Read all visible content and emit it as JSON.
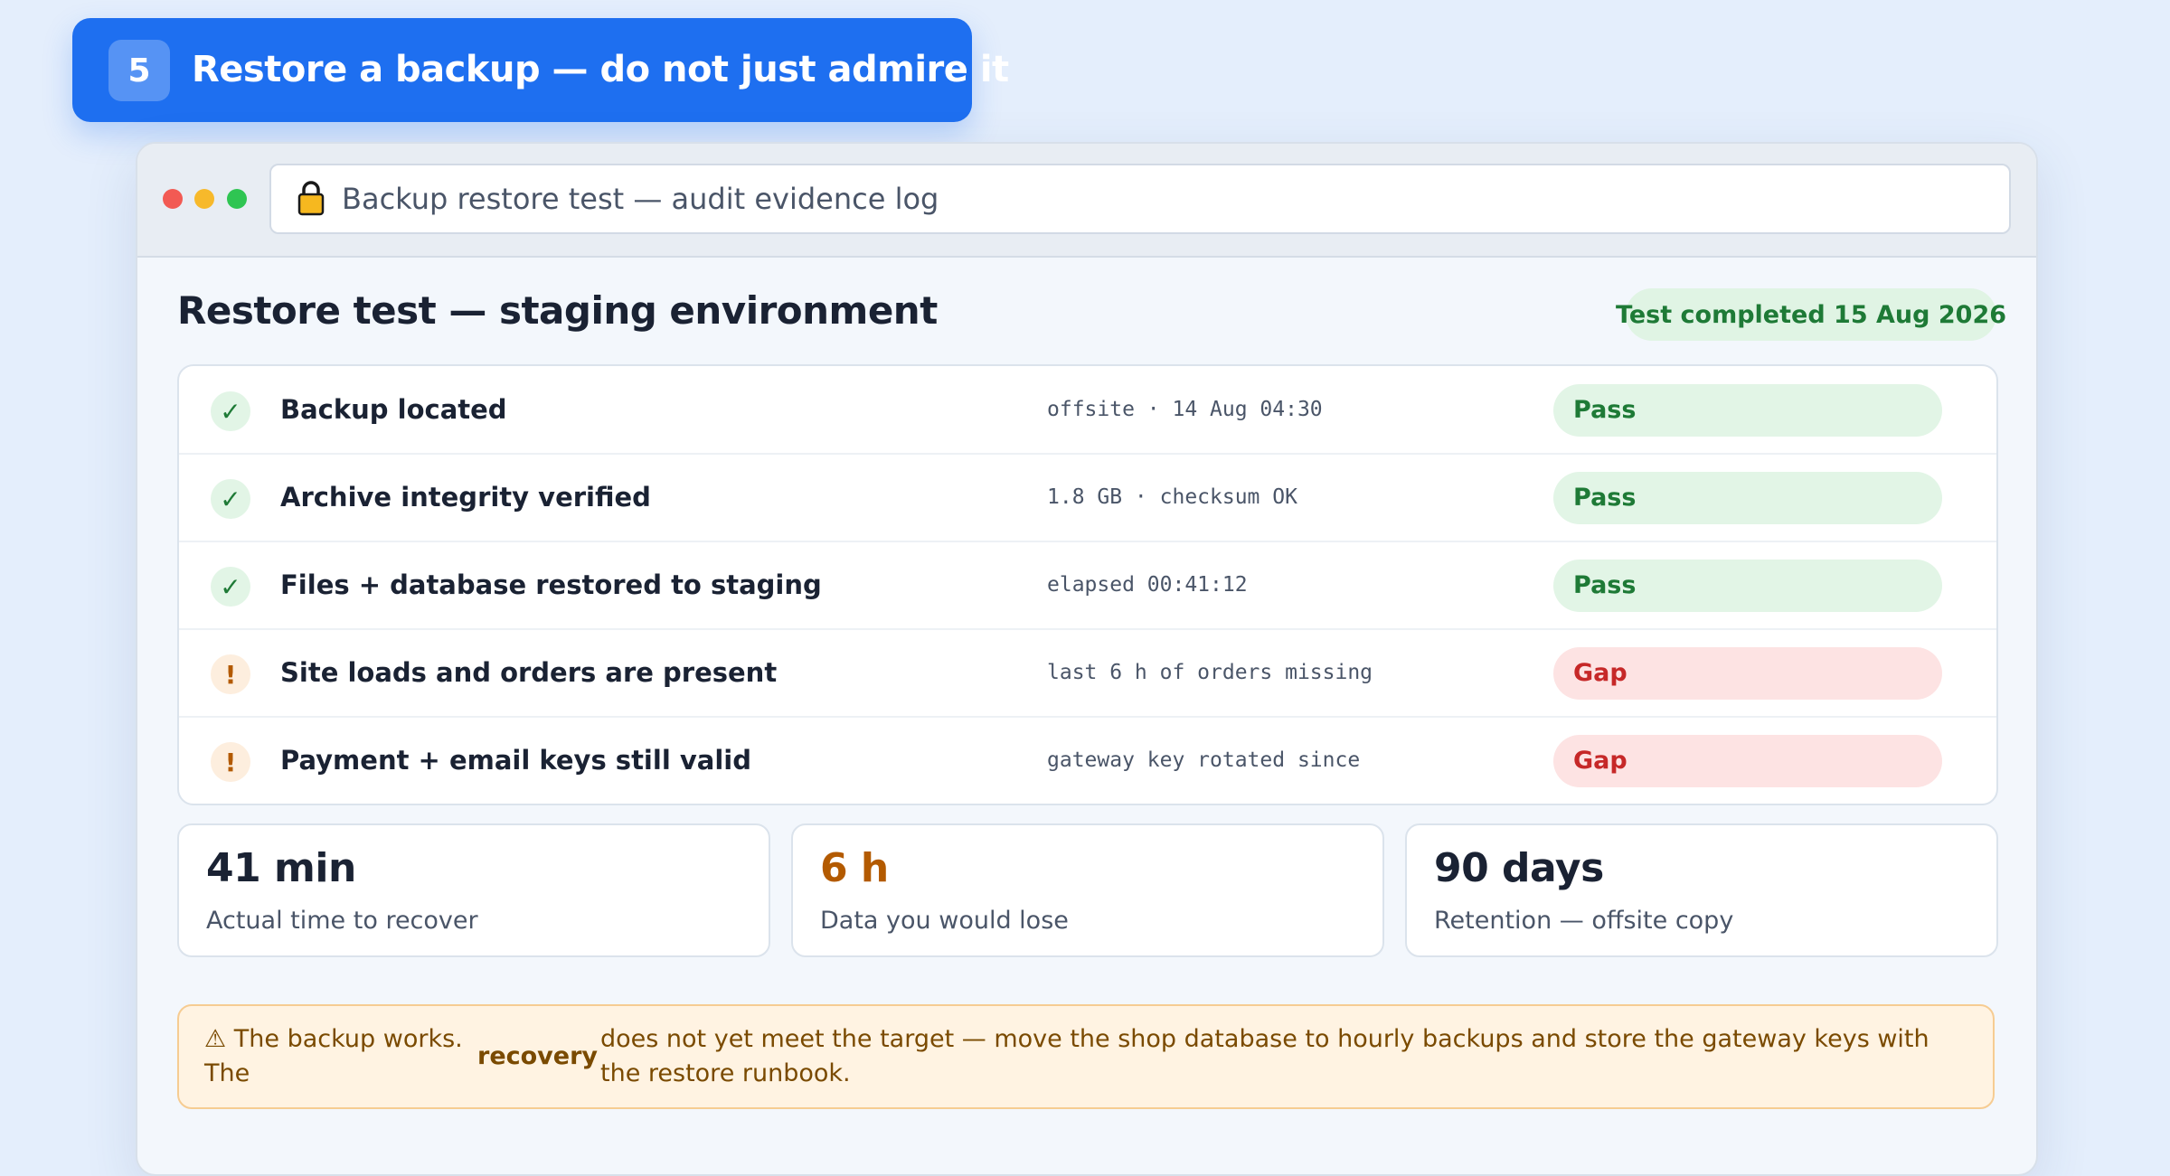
{
  "step": {
    "number": "5",
    "title": "Restore a backup — do not just admire it"
  },
  "window": {
    "address": "Backup restore test — audit evidence log"
  },
  "header": {
    "title": "Restore test — staging environment",
    "status": "Test completed 15 Aug 2026"
  },
  "checks": [
    {
      "label": "Backup located",
      "detail": "offsite · 14 Aug 04:30",
      "result": "Pass",
      "icon": "✓"
    },
    {
      "label": "Archive integrity verified",
      "detail": "1.8 GB · checksum OK",
      "result": "Pass",
      "icon": "✓"
    },
    {
      "label": "Files + database restored to staging",
      "detail": "elapsed 00:41:12",
      "result": "Pass",
      "icon": "✓"
    },
    {
      "label": "Site loads and orders are present",
      "detail": "last 6 h of orders missing",
      "result": "Gap",
      "icon": "!"
    },
    {
      "label": "Payment + email keys still valid",
      "detail": "gateway key rotated since",
      "result": "Gap",
      "icon": "!"
    }
  ],
  "metrics": [
    {
      "value": "41 min",
      "label": "Actual time to recover"
    },
    {
      "value": "6 h",
      "label": "Data you would lose"
    },
    {
      "value": "90 days",
      "label": "Retention — offsite copy"
    }
  ],
  "warning": {
    "part1": "⚠ The backup works. The",
    "part2": "recovery",
    "part3": "does not yet meet the target — move the shop database to hourly backups and store the gateway keys with the restore runbook."
  },
  "colors": {
    "accent": "#1e6ff0",
    "pass": "#1e7a36",
    "gap": "#c62828",
    "warn": "#b35a00"
  }
}
